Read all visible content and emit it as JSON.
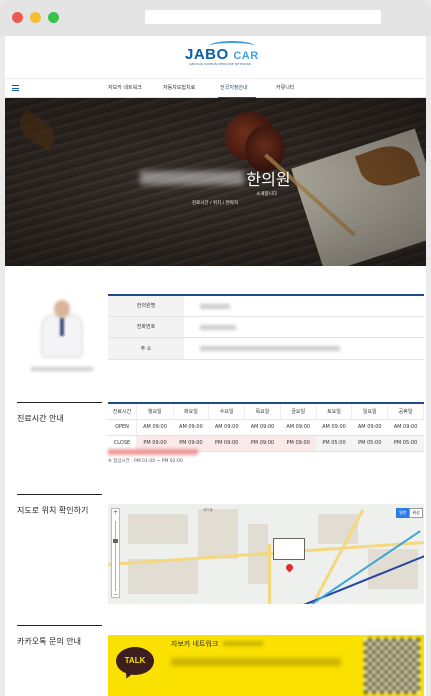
{
  "logo": {
    "word": "JABO",
    "car": "CAR",
    "subtitle": "JABOCAR KOREAN MEDICINE NETWORK"
  },
  "nav": {
    "items": [
      {
        "label": "자보카 네트워크"
      },
      {
        "label": "자동차보험치료"
      },
      {
        "label": "전국지정안내"
      },
      {
        "label": "커뮤니티"
      }
    ]
  },
  "hero": {
    "name": "한의원",
    "subtitle": "소개합니다",
    "breadcrumb": "진료시간 / 위치 / 연락처"
  },
  "info": {
    "labels": [
      "한의원명",
      "전화번호",
      "주 소"
    ]
  },
  "sections": {
    "hours": "진료시간 안내",
    "map": "지도로 위치 확인하기",
    "kakao": "카카오톡 문의 안내"
  },
  "hours": {
    "header": [
      "진료시간",
      "월요일",
      "화요일",
      "수요일",
      "목요일",
      "금요일",
      "토요일",
      "일요일",
      "공휴일"
    ],
    "rows": [
      {
        "label": "OPEN",
        "cells": [
          "AM 09:00",
          "AM 09:00",
          "AM 09:00",
          "AM 09:00",
          "AM 09:00",
          "AM 09:00",
          "AM 09:00",
          "AM 09:00"
        ]
      },
      {
        "label": "CLOSE",
        "cells": [
          "PM 09:00",
          "PM 09:00",
          "PM 09:00",
          "PM 09:00",
          "PM 09:00",
          "PM 05:00",
          "PM 05:00",
          "PM 05:00"
        ]
      }
    ],
    "note": "※ 점심시간 : PM 01:00 ~ PM 02:00"
  },
  "map": {
    "type_buttons": [
      "일반",
      "위성"
    ],
    "place": "세기동"
  },
  "kakao": {
    "talk": "TALK",
    "title": "자보카 네트워크"
  }
}
